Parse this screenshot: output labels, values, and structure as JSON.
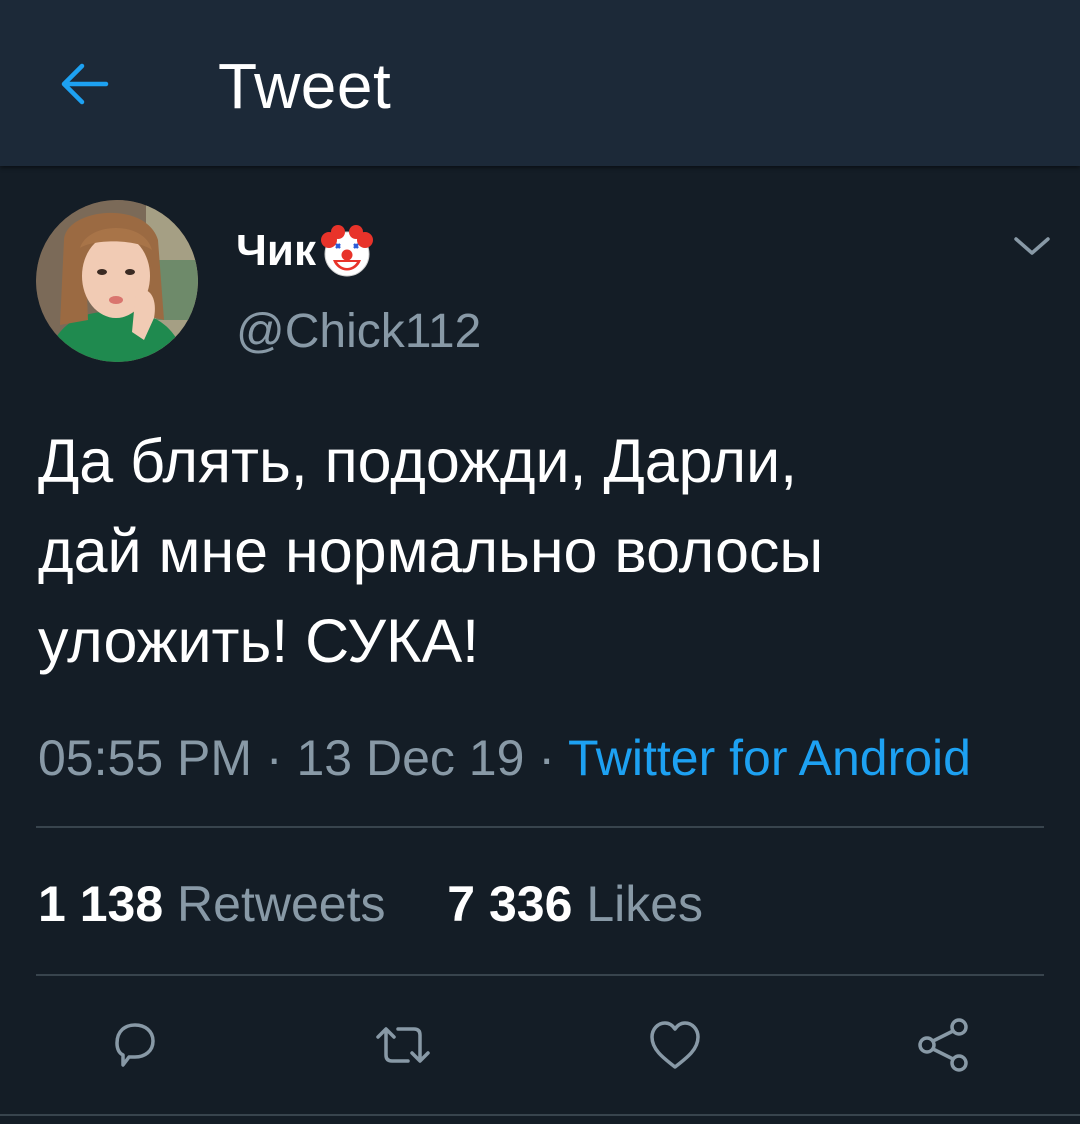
{
  "header": {
    "title": "Tweet",
    "back_icon": "arrow-left-icon"
  },
  "tweet": {
    "author": {
      "display_name": "Чик",
      "name_emoji_icon": "clown-face-icon",
      "handle": "@Chick112",
      "avatar": "profile-photo"
    },
    "text_lines": [
      "Да блять, подожди, Дарли,",
      "дай мне нормально волосы",
      "уложить! СУКА!"
    ],
    "time": "05:55 PM",
    "date": "13 Dec 19",
    "separator": "·",
    "source": "Twitter for Android",
    "retweets_count": "1 138",
    "retweets_label": "Retweets",
    "likes_count": "7 336",
    "likes_label": "Likes"
  },
  "actions": {
    "reply_icon": "reply-icon",
    "retweet_icon": "retweet-icon",
    "like_icon": "heart-icon",
    "share_icon": "share-icon"
  },
  "colors": {
    "background": "#141d26",
    "topbar": "#1c2938",
    "accent": "#1da1f2",
    "secondary_text": "#8899a6",
    "divider": "#38444d"
  }
}
